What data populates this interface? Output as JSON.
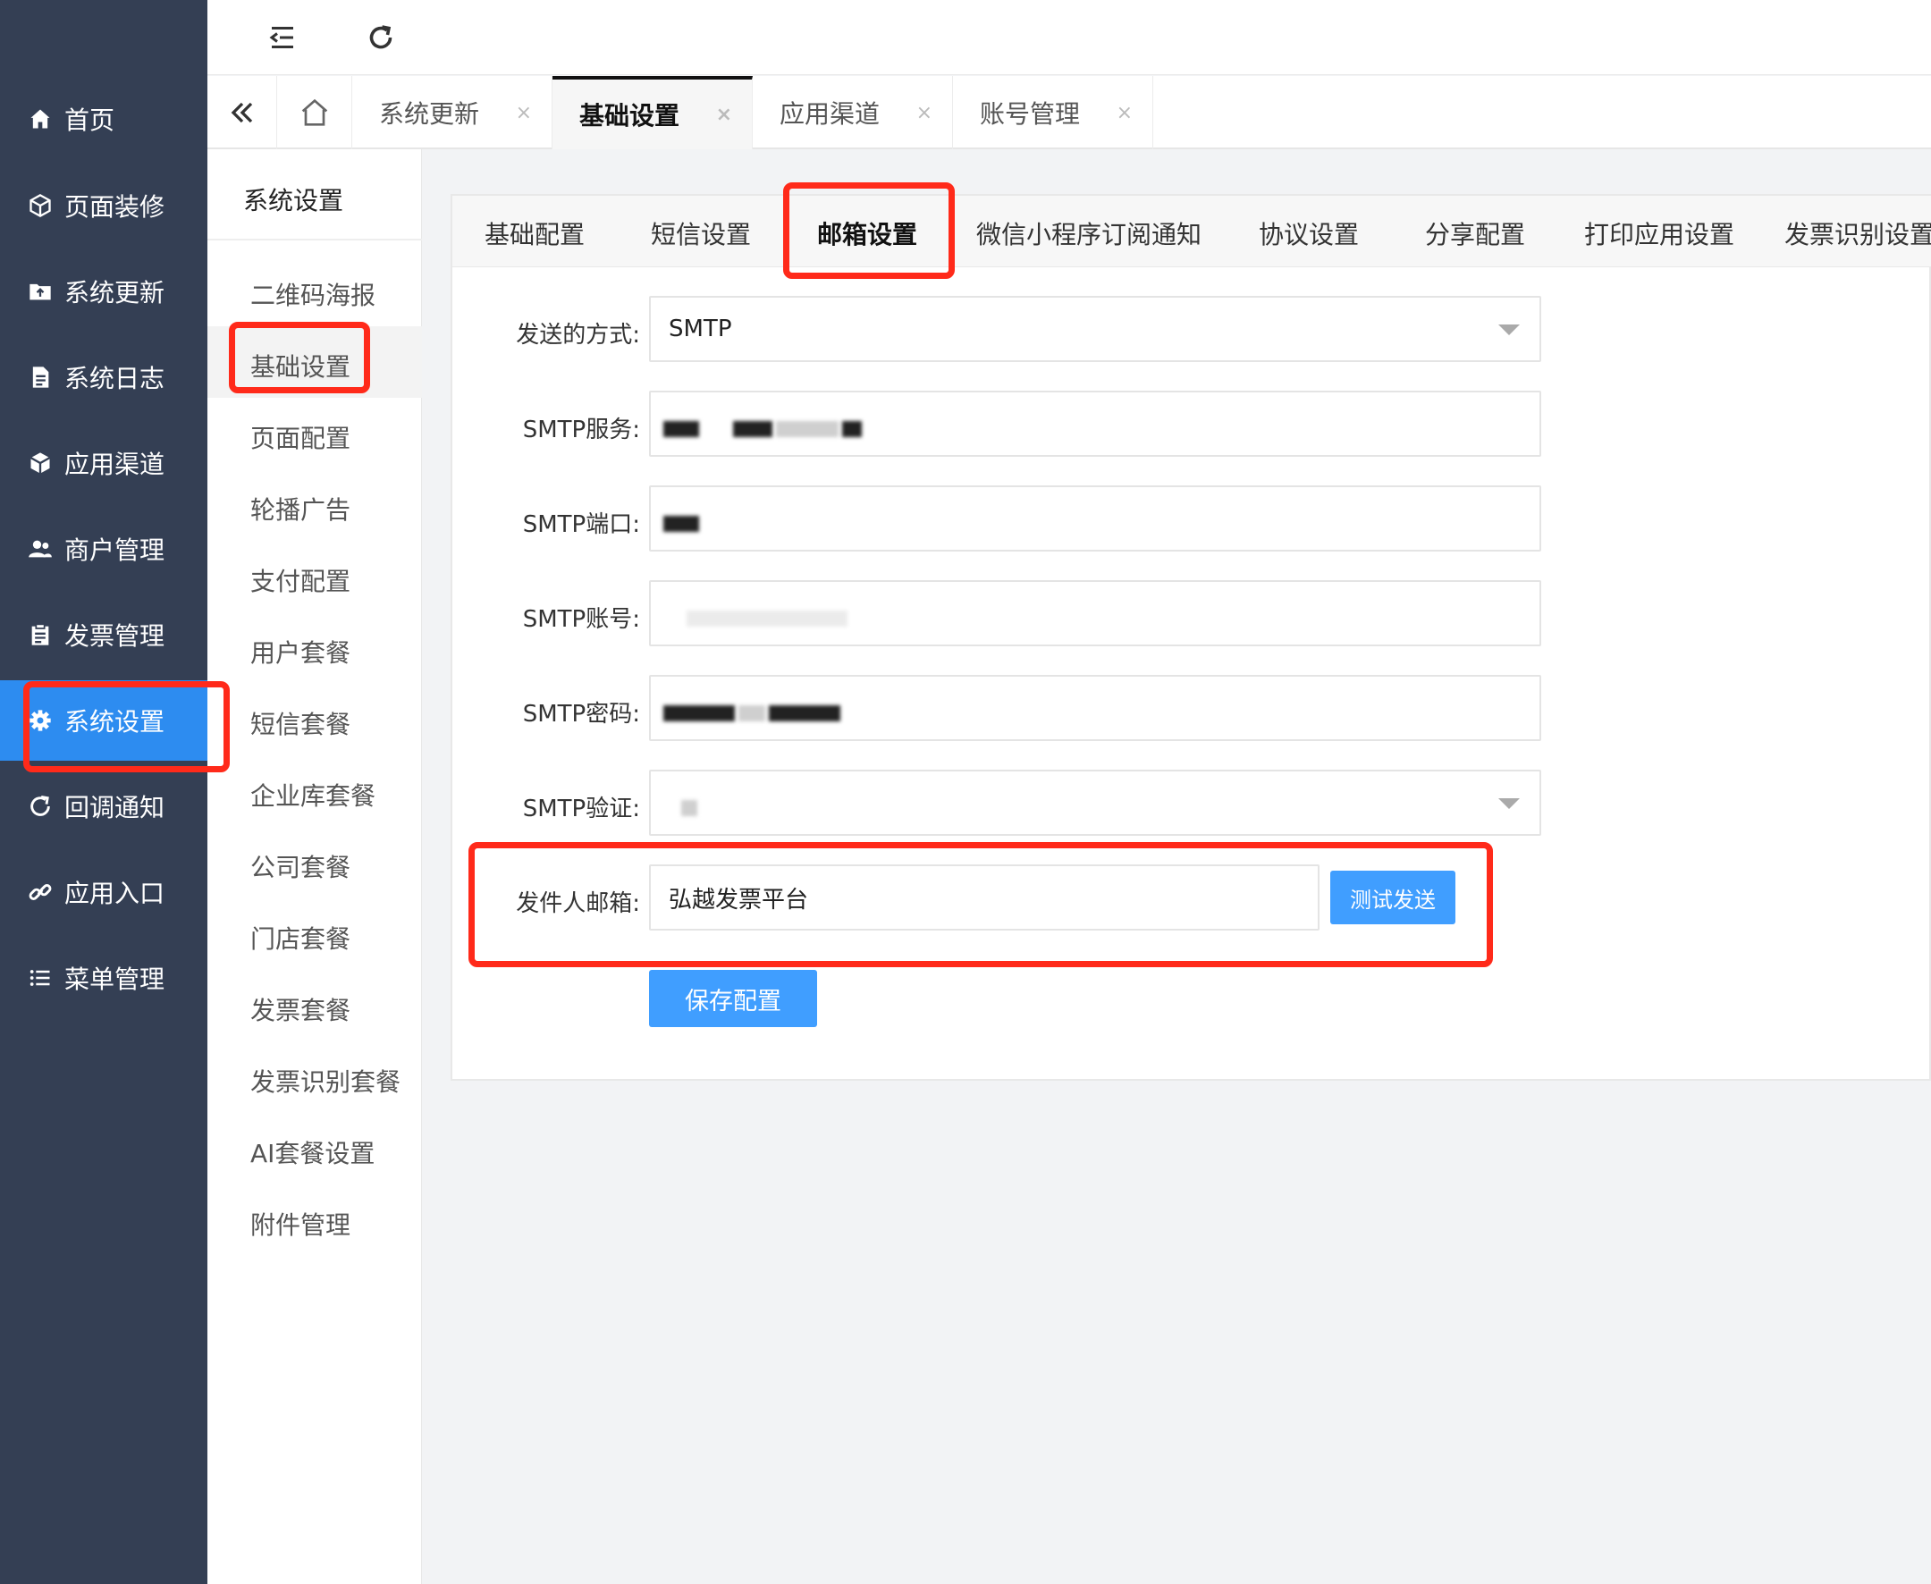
{
  "sidebar": {
    "items": [
      {
        "label": "首页",
        "icon": "home-icon"
      },
      {
        "label": "页面装修",
        "icon": "cube-outline-icon"
      },
      {
        "label": "系统更新",
        "icon": "folder-update-icon"
      },
      {
        "label": "系统日志",
        "icon": "document-icon"
      },
      {
        "label": "应用渠道",
        "icon": "package-icon"
      },
      {
        "label": "商户管理",
        "icon": "users-icon"
      },
      {
        "label": "发票管理",
        "icon": "clipboard-icon"
      },
      {
        "label": "系统设置",
        "icon": "gear-icon"
      },
      {
        "label": "回调通知",
        "icon": "refresh-icon"
      },
      {
        "label": "应用入口",
        "icon": "link-icon"
      },
      {
        "label": "菜单管理",
        "icon": "list-icon"
      }
    ],
    "active": "系统设置"
  },
  "tabbar": {
    "tabs": [
      {
        "label": "系统更新",
        "close": "×"
      },
      {
        "label": "基础设置",
        "close": "×"
      },
      {
        "label": "应用渠道",
        "close": "×"
      },
      {
        "label": "账号管理",
        "close": "×"
      }
    ],
    "active": "基础设置"
  },
  "subnav": {
    "title": "系统设置",
    "items": [
      "二维码海报",
      "基础设置",
      "页面配置",
      "轮播广告",
      "支付配置",
      "用户套餐",
      "短信套餐",
      "企业库套餐",
      "公司套餐",
      "门店套餐",
      "发票套餐",
      "发票识别套餐",
      "AI套餐设置",
      "附件管理"
    ],
    "active": "基础设置"
  },
  "settings_tabs": {
    "items": [
      "基础配置",
      "短信设置",
      "邮箱设置",
      "微信小程序订阅通知",
      "协议设置",
      "分享配置",
      "打印应用设置",
      "发票识别设置"
    ],
    "active": "邮箱设置"
  },
  "form": {
    "send_method_label": "发送的方式:",
    "send_method_value": "SMTP",
    "smtp_server_label": "SMTP服务:",
    "smtp_port_label": "SMTP端口:",
    "smtp_account_label": "SMTP账号:",
    "smtp_password_label": "SMTP密码:",
    "smtp_verify_label": "SMTP验证:",
    "sender_label": "发件人邮箱:",
    "sender_value": "弘越发票平台",
    "test_send_button": "测试发送",
    "save_button": "保存配置"
  },
  "colors": {
    "sidebar_bg": "#343f54",
    "sidebar_active": "#2d8cf0",
    "primary_button": "#409eff",
    "annotation_red": "#ff2a1a"
  }
}
